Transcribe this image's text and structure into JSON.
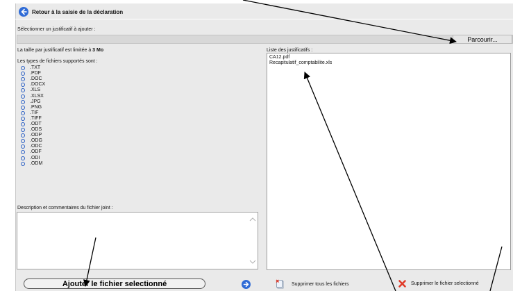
{
  "header": {
    "back_label": "Retour à la saisie de la déclaration"
  },
  "upload": {
    "select_label": "Sélectionner un justificatif à ajouter :",
    "file_value": "",
    "browse_label": "Parcourir...",
    "size_limit_prefix": "La taille par justificatif est limitée à ",
    "size_limit_value": "3 Mo",
    "types_label": "Les types de fichiers supportés sont :",
    "file_types": [
      ".TXT",
      ".PDF",
      ".DOC",
      ".DOCX",
      ".XLS",
      ".XLSX",
      ".JPG",
      ".PNG",
      ".TIF",
      ".TIFF",
      ".ODT",
      ".ODS",
      ".ODP",
      ".ODG",
      ".ODC",
      ".ODF",
      ".ODI",
      ".ODM"
    ]
  },
  "justificatifs": {
    "label": "Liste des justificatifs :",
    "files": [
      "CA12.pdf",
      "Recapitulatif_comptabilite.xls"
    ]
  },
  "description": {
    "label": "Description et commentaires du fichier joint :",
    "value": ""
  },
  "actions": {
    "add_label": "Ajouter le fichier selectionné",
    "delete_all_label": "Supprimer tous les fichiers",
    "delete_selected_label": "Supprimer le fichier selectionné"
  },
  "colors": {
    "accent": "#2f6bd6",
    "panel": "#eaeaea",
    "delete_red": "#e03a28"
  },
  "icons": {
    "back": "back-arrow-icon",
    "go": "go-arrow-icon",
    "delete_all": "delete-all-icon",
    "delete_selected": "delete-x-icon",
    "annotations": "pointer-arrow"
  }
}
